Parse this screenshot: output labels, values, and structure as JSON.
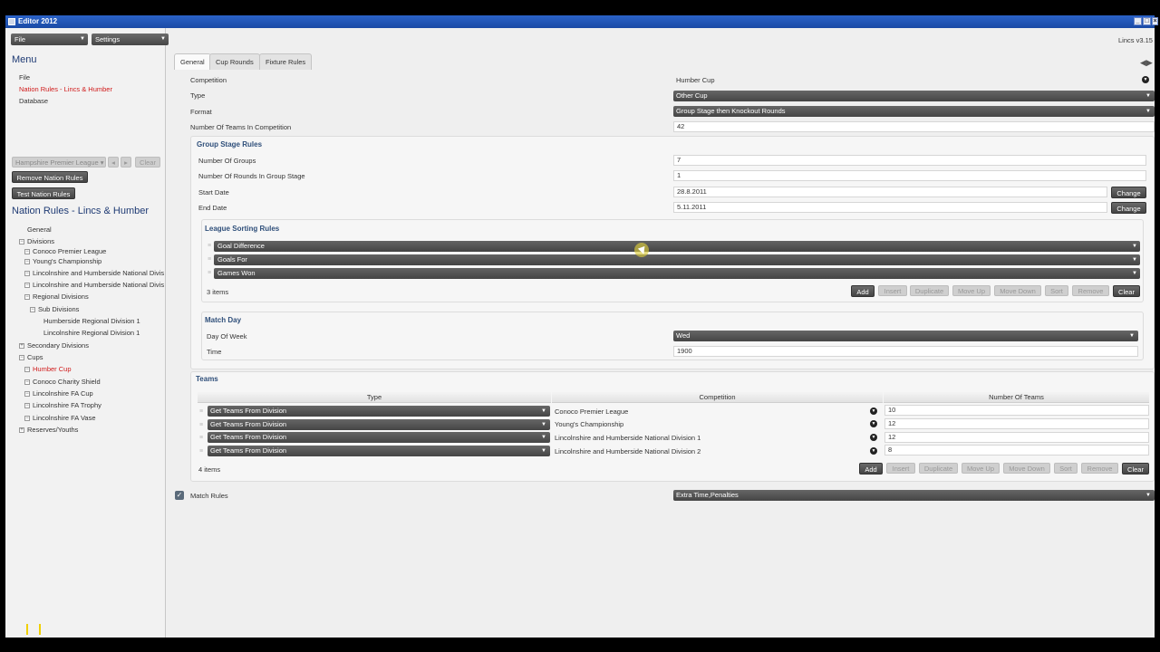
{
  "window": {
    "title": "Editor 2012",
    "version": "Lincs v3.15"
  },
  "topbar": {
    "file": "File",
    "settings": "Settings"
  },
  "sidebar": {
    "menu_title": "Menu",
    "menu_items": [
      "File",
      "Nation Rules - Lincs & Humber",
      "Database"
    ],
    "nation_select": "Hampshire Premier League",
    "clear": "Clear",
    "remove_btn": "Remove Nation Rules",
    "test_btn": "Test Nation Rules",
    "section_title": "Nation Rules - Lincs & Humber",
    "tree": {
      "general": "General",
      "divisions": "Divisions",
      "d1": "Conoco Premier League",
      "d2": "Young's Championship",
      "d3": "Lincolnshire and Humberside National Divis",
      "d4": "Lincolnshire and Humberside National Divis",
      "regional": "Regional Divisions",
      "subdiv": "Sub Divisions",
      "r1": "Humberside Regional Division 1",
      "r2": "Lincolnshire Regional Division 1",
      "secondary": "Secondary Divisions",
      "cups": "Cups",
      "c1": "Humber Cup",
      "c2": "Conoco Charity Shield",
      "c3": "Lincolnshire FA Cup",
      "c4": "Lincolnshire FA Trophy",
      "c5": "Lincolnshire FA Vase",
      "reserves": "Reserves/Youths"
    }
  },
  "tabs": [
    "General",
    "Cup Rounds",
    "Fixture Rules"
  ],
  "general": {
    "competition_label": "Competition",
    "competition_value": "Humber Cup",
    "type_label": "Type",
    "type_value": "Other Cup",
    "format_label": "Format",
    "format_value": "Group Stage then Knockout Rounds",
    "teams_label": "Number Of Teams In Competition",
    "teams_value": "42"
  },
  "group_stage": {
    "title": "Group Stage Rules",
    "groups_label": "Number Of Groups",
    "groups_value": "7",
    "rounds_label": "Number Of Rounds In Group Stage",
    "rounds_value": "1",
    "start_label": "Start Date",
    "start_value": "28.8.2011",
    "end_label": "End Date",
    "end_value": "5.11.2011",
    "change": "Change"
  },
  "league_sorting": {
    "title": "League Sorting Rules",
    "rows": [
      "Goal Difference",
      "Goals For",
      "Games Won"
    ],
    "count": "3 items"
  },
  "buttons": {
    "add": "Add",
    "insert": "Insert",
    "duplicate": "Duplicate",
    "move_up": "Move Up",
    "move_down": "Move Down",
    "sort": "Sort",
    "remove": "Remove",
    "clear": "Clear"
  },
  "match_day": {
    "title": "Match Day",
    "dow_label": "Day Of Week",
    "dow_value": "Wed",
    "time_label": "Time",
    "time_value": "1900"
  },
  "teams": {
    "title": "Teams",
    "col_type": "Type",
    "col_competition": "Competition",
    "col_num": "Number Of Teams",
    "rows": [
      {
        "type": "Get Teams From Division",
        "competition": "Conoco Premier League",
        "num": "10"
      },
      {
        "type": "Get Teams From Division",
        "competition": "Young's Championship",
        "num": "12"
      },
      {
        "type": "Get Teams From Division",
        "competition": "Lincolnshire and Humberside National Division 1",
        "num": "12"
      },
      {
        "type": "Get Teams From Division",
        "competition": "Lincolnshire and Humberside National Division 2",
        "num": "8"
      }
    ],
    "count": "4 items"
  },
  "match_rules": {
    "label": "Match Rules",
    "value": "Extra Time,Penalties"
  }
}
